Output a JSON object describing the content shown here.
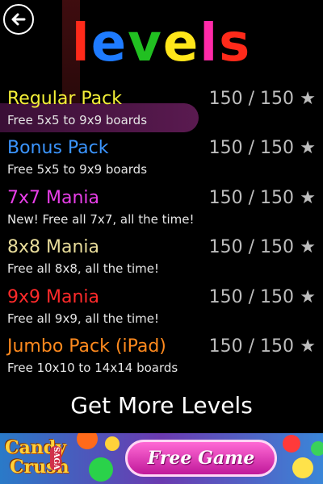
{
  "header": {
    "back_icon": "back-arrow-icon",
    "title_letters": [
      {
        "char": "l",
        "color": "#ff2a1a"
      },
      {
        "char": "e",
        "color": "#1e7bff"
      },
      {
        "char": "v",
        "color": "#21c021"
      },
      {
        "char": "e",
        "color": "#ffe61a"
      },
      {
        "char": "l",
        "color": "#ff2aa8"
      },
      {
        "char": "s",
        "color": "#ff2a1a"
      }
    ]
  },
  "packs": [
    {
      "name": "Regular Pack",
      "desc": "Free 5x5 to 9x9 boards",
      "count": "150 / 150",
      "star": "★",
      "color": "#f4f038"
    },
    {
      "name": "Bonus Pack",
      "desc": "Free 5x5 to 9x9 boards",
      "count": "150 / 150",
      "star": "★",
      "color": "#3b95ff"
    },
    {
      "name": "7x7 Mania",
      "desc": "New! Free all 7x7, all the time!",
      "count": "150 / 150",
      "star": "★",
      "color": "#e83ee8"
    },
    {
      "name": "8x8 Mania",
      "desc": "Free all 8x8, all the time!",
      "count": "150 / 150",
      "star": "★",
      "color": "#e8dc9a"
    },
    {
      "name": "9x9 Mania",
      "desc": "Free all 9x9, all the time!",
      "count": "150 / 150",
      "star": "★",
      "color": "#ff2a2a"
    },
    {
      "name": "Jumbo Pack (iPad)",
      "desc": "Free 10x10 to 14x14 boards",
      "count": "150 / 150",
      "star": "★",
      "color": "#ff8a1e"
    }
  ],
  "more_levels_label": "Get More Levels",
  "ad": {
    "logo_line1": "Candy",
    "logo_line2": "Crush",
    "logo_saga": "SAGA",
    "button_label": "Free Game"
  }
}
